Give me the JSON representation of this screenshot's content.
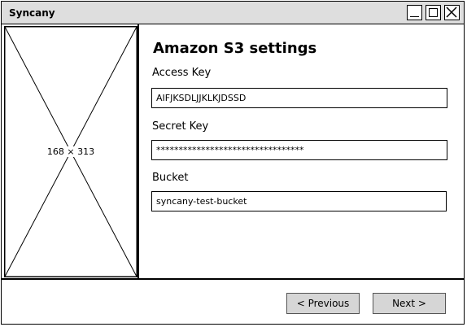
{
  "window": {
    "title": "Syncany"
  },
  "image_placeholder": {
    "label": "168 × 313"
  },
  "form": {
    "heading": "Amazon S3 settings",
    "access_key": {
      "label": "Access Key",
      "value": "AIFJKSDLJJKLKJDSSD"
    },
    "secret_key": {
      "label": "Secret Key",
      "value": "*********************************"
    },
    "bucket": {
      "label": "Bucket",
      "value": "syncany-test-bucket"
    }
  },
  "buttons": {
    "previous": "< Previous",
    "next": "Next >"
  }
}
